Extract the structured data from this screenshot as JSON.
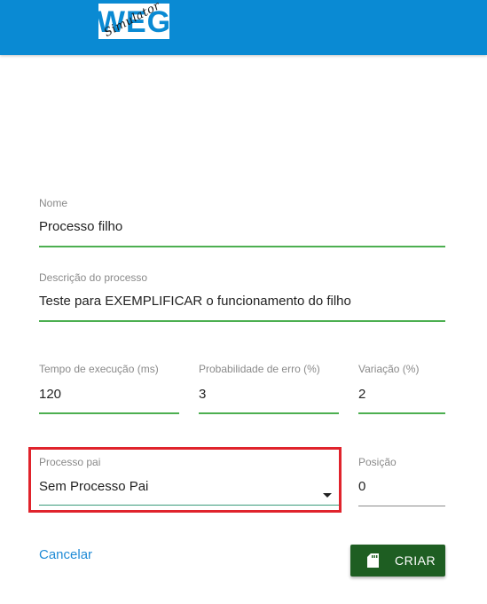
{
  "header": {
    "logo_text": "WEG",
    "logo_script": "Simulator"
  },
  "form": {
    "name": {
      "label": "Nome",
      "value": "Processo filho"
    },
    "description": {
      "label": "Descrição do processo",
      "value": "Teste para EXEMPLIFICAR o funcionamento do filho"
    },
    "execution_time": {
      "label": "Tempo de execução (ms)",
      "value": "120"
    },
    "error_probability": {
      "label": "Probabilidade de erro (%)",
      "value": "3"
    },
    "variation": {
      "label": "Variação (%)",
      "value": "2"
    },
    "parent_process": {
      "label": "Processo pai",
      "selected": "Sem Processo Pai"
    },
    "position": {
      "label": "Posição",
      "value": "0"
    }
  },
  "actions": {
    "cancel_label": "Cancelar",
    "create_label": "CRIAR"
  },
  "colors": {
    "header": "#0a8ad3",
    "field_underline": "#4caf50",
    "highlight": "#e0232c",
    "create_button": "#1e5e22",
    "link": "#1f8bd6"
  },
  "icons": {
    "create_button_icon": "sd-card-icon",
    "dropdown_icon": "caret-down-icon"
  }
}
